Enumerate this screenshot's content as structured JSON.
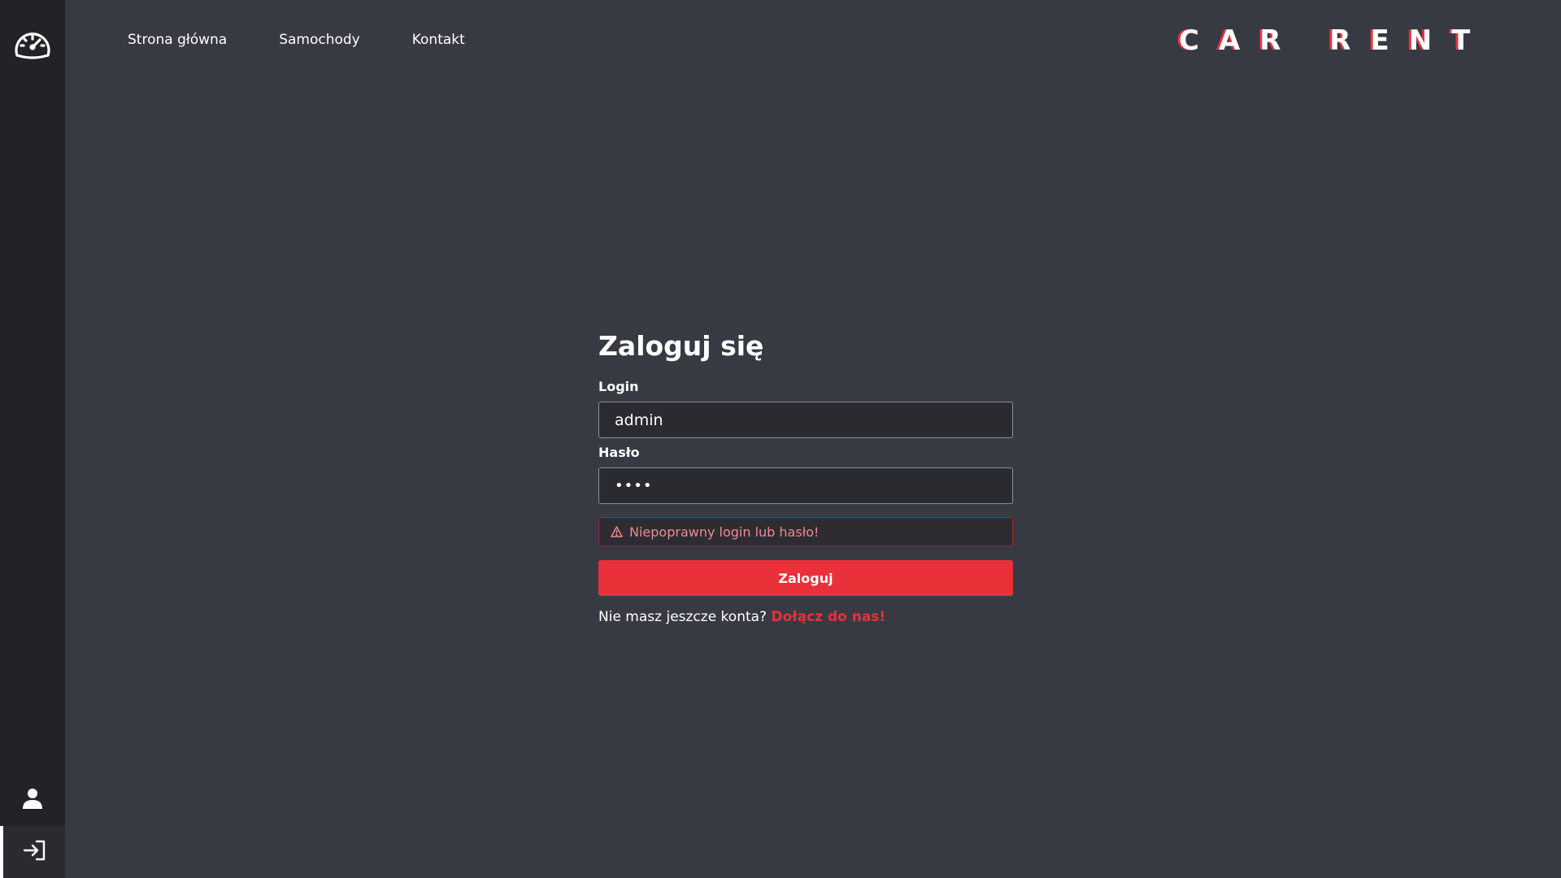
{
  "nav": {
    "items": [
      {
        "label": "Strona główna"
      },
      {
        "label": "Samochody"
      },
      {
        "label": "Kontakt"
      }
    ],
    "brand": "CAR RENT"
  },
  "sidebar": {
    "top_icon": "speedometer-icon",
    "bottom_icons": [
      "user-icon",
      "login-icon"
    ]
  },
  "login": {
    "title": "Zaloguj się",
    "login_label": "Login",
    "login_value": "admin",
    "password_label": "Hasło",
    "password_value": "••••",
    "error_text": "Niepoprawny login lub hasło!",
    "submit_label": "Zaloguj",
    "register_prompt": "Nie masz jeszcze konta?",
    "register_link": "Dołącz do nas!"
  },
  "colors": {
    "accent": "#ea3039",
    "background": "#373a43",
    "sidebar": "#222327",
    "error_text": "#ef8a90"
  }
}
